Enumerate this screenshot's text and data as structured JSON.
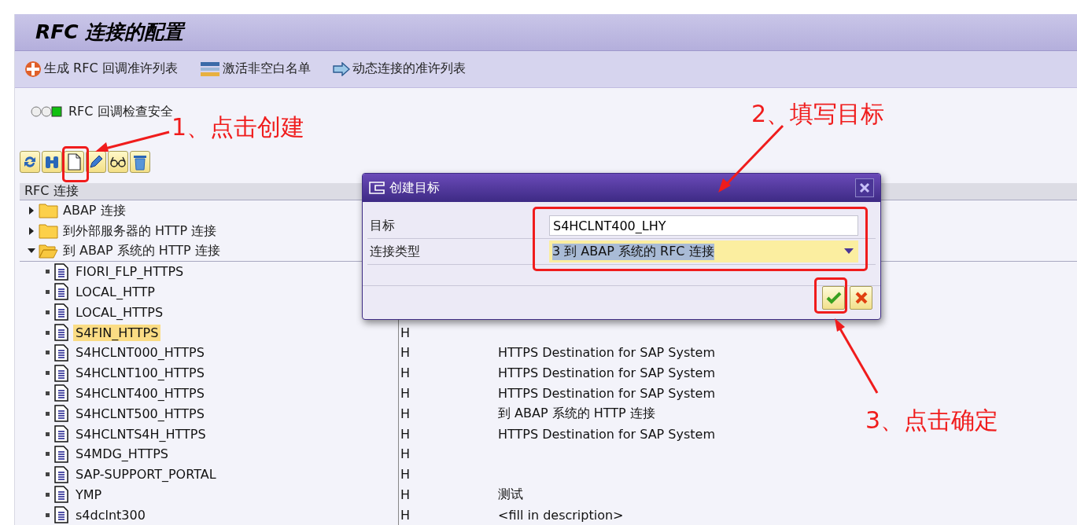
{
  "title": "RFC 连接的配置",
  "actions": [
    {
      "kind": "generate",
      "label": "生成 RFC 回调准许列表"
    },
    {
      "kind": "activate",
      "label": "激活非空白名单"
    },
    {
      "kind": "arrow",
      "label": "动态连接的准许列表"
    }
  ],
  "security": {
    "label": "RFC 回调检查安全",
    "lights": [
      {
        "on": false
      },
      {
        "on": false
      },
      {
        "on": true
      }
    ]
  },
  "tool_buttons": [
    {
      "kind": "refresh"
    },
    {
      "kind": "find"
    },
    {
      "kind": "create"
    },
    {
      "kind": "edit"
    },
    {
      "kind": "display"
    },
    {
      "kind": "delete"
    }
  ],
  "tree": {
    "header": "RFC 连接",
    "nodes": [
      {
        "label": "ABAP 连接",
        "expanded": false
      },
      {
        "label": "到外部服务器的 HTTP 连接",
        "expanded": false
      },
      {
        "label": "到 ABAP 系统的 HTTP 连接",
        "expanded": true,
        "children": [
          {
            "name": "FIORI_FLP_HTTPS",
            "selected": false
          },
          {
            "name": "LOCAL_HTTP",
            "selected": false
          },
          {
            "name": "LOCAL_HTTPS",
            "selected": false
          },
          {
            "name": "S4FIN_HTTPS",
            "selected": true,
            "column_2": "H"
          },
          {
            "name": "S4HCLNT000_HTTPS",
            "selected": false,
            "column_2": "H",
            "description": "HTTPS Destination for SAP System"
          },
          {
            "name": "S4HCLNT100_HTTPS",
            "selected": false,
            "column_2": "H",
            "description": "HTTPS Destination for SAP System"
          },
          {
            "name": "S4HCLNT400_HTTPS",
            "selected": false,
            "column_2": "H",
            "description": "HTTPS Destination for SAP System"
          },
          {
            "name": "S4HCLNT500_HTTPS",
            "selected": false,
            "column_2": "H",
            "description": "到 ABAP 系统的 HTTP 连接"
          },
          {
            "name": "S4HCLNTS4H_HTTPS",
            "selected": false,
            "column_2": "H",
            "description": "HTTPS Destination for SAP System"
          },
          {
            "name": "S4MDG_HTTPS",
            "selected": false,
            "column_2": "H"
          },
          {
            "name": "SAP-SUPPORT_PORTAL",
            "selected": false,
            "column_2": "H"
          },
          {
            "name": "YMP",
            "selected": false,
            "column_2": "H",
            "description": "测试"
          },
          {
            "name": "s4dclnt300",
            "selected": false,
            "column_2": "H",
            "description": "<fill in description>"
          }
        ]
      }
    ]
  },
  "dialog": {
    "title": "创建目标",
    "fields": [
      {
        "kind": "text",
        "label": "目标",
        "value": "S4HCLNT400_LHY"
      },
      {
        "kind": "dropdown",
        "label": "连接类型",
        "value": "3 到 ABAP 系统的 RFC 连接"
      }
    ],
    "buttons": [
      {
        "kind": "confirm"
      },
      {
        "kind": "cancel"
      }
    ]
  },
  "annotations": [
    {
      "text": "1、点击创建"
    },
    {
      "text": "2、填写目标"
    },
    {
      "text": "3、点击确定"
    }
  ]
}
